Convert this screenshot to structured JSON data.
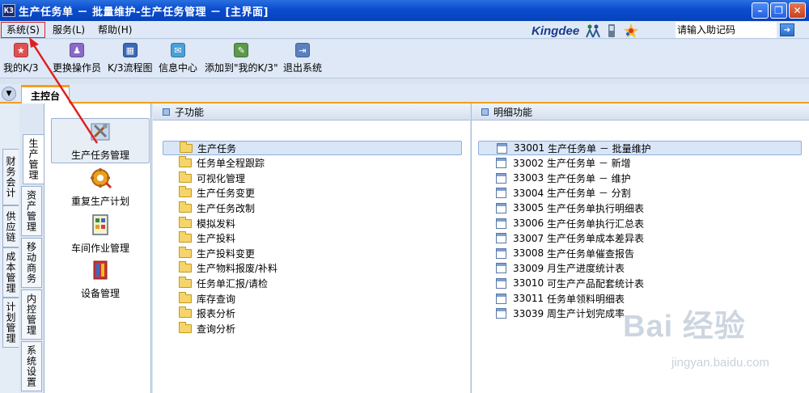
{
  "window": {
    "title": "生产任务单 － 批量维护-生产任务管理 － [主界面]",
    "logo_text": "K3"
  },
  "menubar": {
    "items": [
      "系统(S)",
      "服务(L)",
      "帮助(H)"
    ]
  },
  "brand": {
    "name": "Kingdee"
  },
  "help_search": {
    "placeholder": "请输入助记码"
  },
  "toolbar": {
    "buttons": [
      {
        "label": "我的K/3",
        "icon": "star-icon"
      },
      {
        "label": "更换操作员",
        "icon": "users-icon"
      },
      {
        "label": "K/3流程图",
        "icon": "flowchart-icon"
      },
      {
        "label": "信息中心",
        "icon": "message-icon"
      },
      {
        "label": "添加到\"我的K/3\"",
        "icon": "add-favorite-icon"
      },
      {
        "label": "退出系统",
        "icon": "exit-icon"
      }
    ]
  },
  "tabstrip": {
    "active_tab": "主控台"
  },
  "outer_tabs": [
    "财务会计",
    "供应链",
    "成本管理",
    "计划管理"
  ],
  "inner_tabs": [
    "生产管理",
    "资产管理",
    "移动商务",
    "内控管理",
    "系统设置"
  ],
  "modules": [
    {
      "label": "生产任务管理",
      "icon": "tools-icon"
    },
    {
      "label": "重复生产计划",
      "icon": "gear-icon"
    },
    {
      "label": "车间作业管理",
      "icon": "schedule-board-icon"
    },
    {
      "label": "设备管理",
      "icon": "equipment-icon"
    }
  ],
  "sub_functions": {
    "header": "子功能",
    "items": [
      "生产任务",
      "任务单全程跟踪",
      "可视化管理",
      "生产任务变更",
      "生产任务改制",
      "模拟发料",
      "生产投料",
      "生产投料变更",
      "生产物料报废/补料",
      "任务单汇报/请检",
      "库存查询",
      "报表分析",
      "查询分析"
    ]
  },
  "detail_functions": {
    "header": "明细功能",
    "items": [
      {
        "code": "33001",
        "label": "生产任务单 － 批量维护"
      },
      {
        "code": "33002",
        "label": "生产任务单 － 新增"
      },
      {
        "code": "33003",
        "label": "生产任务单 － 维护"
      },
      {
        "code": "33004",
        "label": "生产任务单 － 分割"
      },
      {
        "code": "33005",
        "label": "生产任务单执行明细表"
      },
      {
        "code": "33006",
        "label": "生产任务单执行汇总表"
      },
      {
        "code": "33007",
        "label": "生产任务单成本差异表"
      },
      {
        "code": "33008",
        "label": "生产任务单催查报告"
      },
      {
        "code": "33009",
        "label": "月生产进度统计表"
      },
      {
        "code": "33010",
        "label": "可生产产品配套统计表"
      },
      {
        "code": "33011",
        "label": "任务单领料明细表"
      },
      {
        "code": "33039",
        "label": "周生产计划完成率"
      }
    ]
  },
  "watermark": {
    "main": "Bai 经验",
    "sub": "jingyan.baidu.com"
  },
  "colors": {
    "title_bar": "#0a4ccf",
    "menu_bg": "#dfe8f6",
    "tab_accent": "#f0a020",
    "annotation_red": "#e02020"
  }
}
